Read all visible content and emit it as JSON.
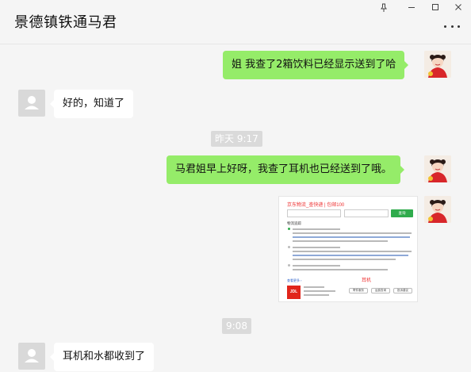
{
  "window": {
    "title": "景德镇铁通马君",
    "pin_icon": "pin-icon",
    "minimize_icon": "minimize-icon",
    "maximize_icon": "maximize-icon",
    "close_icon": "close-icon",
    "more_icon": "more-dots-icon"
  },
  "messages": [
    {
      "side": "right",
      "text": "姐 我查了2箱饮料已经显示送到了哈"
    },
    {
      "side": "left",
      "text": "好的，知道了"
    },
    {
      "type": "time",
      "text": "昨天 9:17"
    },
    {
      "side": "right",
      "text": "马君姐早上好呀，我查了耳机也已经送到了哦。"
    },
    {
      "side": "right",
      "type": "image",
      "caption_text": "耳机"
    },
    {
      "type": "time",
      "text": "9:08"
    },
    {
      "side": "left",
      "text": "耳机和水都收到了"
    }
  ],
  "screenshot": {
    "header": "京东物流_查快递 | 包邮100",
    "search_button": "查询",
    "section": "物流追踪",
    "more_link": "查看更多 ›",
    "mark": "耳机",
    "logo": "JDL",
    "services": [
      "寄件服务",
      "运费查询",
      "投诉建议"
    ]
  },
  "colors": {
    "bubble_right": "#95ec69",
    "bubble_left": "#ffffff",
    "bg": "#f5f5f5",
    "time_bg": "#dadada"
  }
}
